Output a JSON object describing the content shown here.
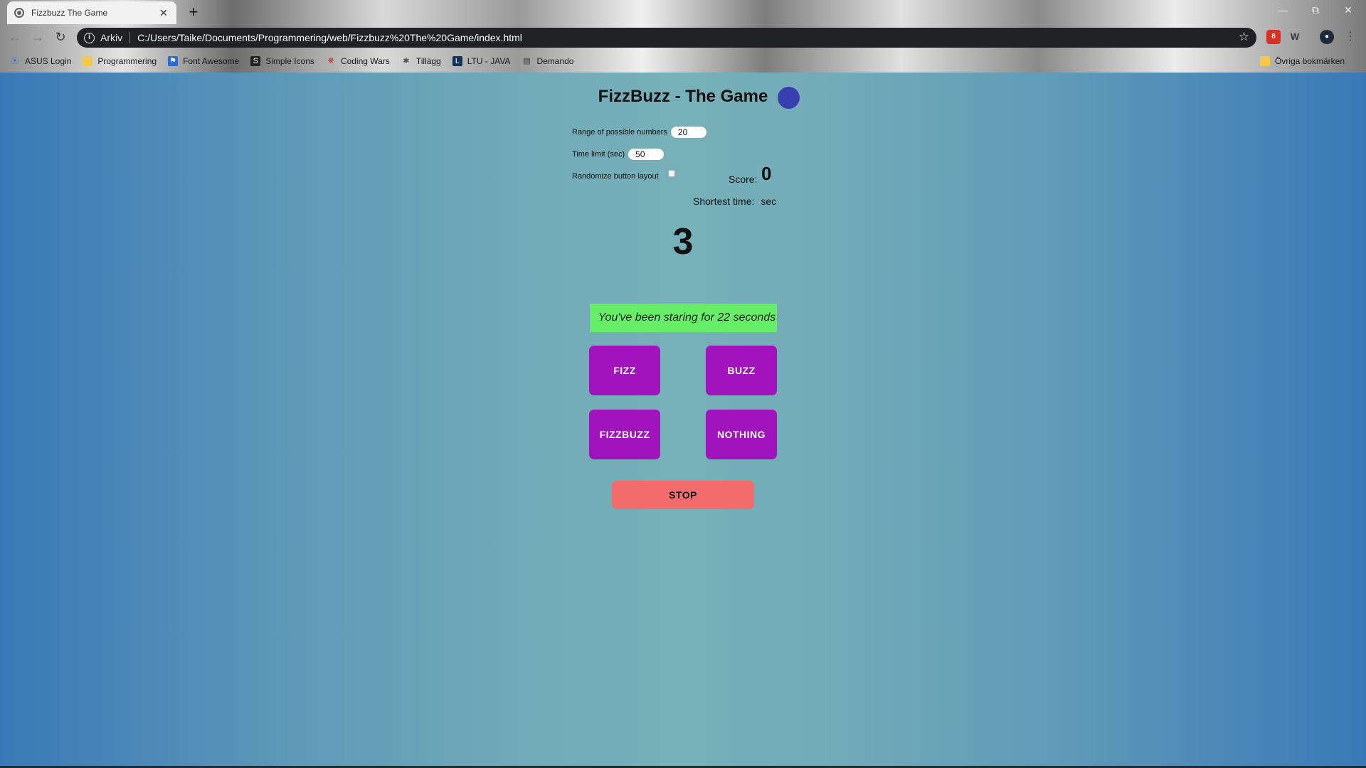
{
  "browser": {
    "tab_title": "Fizzbuzz The Game",
    "tab_close": "✕",
    "new_tab": "+",
    "address_scheme": "Arkiv",
    "address_url": "C:/Users/Taike/Documents/Programmering/web/Fizzbuzz%20The%20Game/index.html",
    "bookmarks": [
      {
        "label": "ASUS Login",
        "icon": "wifi-icon"
      },
      {
        "label": "Programmering",
        "icon": "folder-icon"
      },
      {
        "label": "Font Awesome",
        "icon": "flag-icon"
      },
      {
        "label": "Simple Icons",
        "icon": "simple-icons-icon"
      },
      {
        "label": "Coding Wars",
        "icon": "codewars-icon"
      },
      {
        "label": "Tillägg",
        "icon": "puzzle-icon"
      },
      {
        "label": "LTU - JAVA",
        "icon": "ltu-icon"
      },
      {
        "label": "Demando",
        "icon": "demando-icon"
      }
    ],
    "other_bookmarks": "Övriga bokmärken",
    "extension_badge": "8"
  },
  "game": {
    "title": "FizzBuzz - The Game",
    "range_label": "Range of possible numbers",
    "range_value": "20",
    "time_label": "Time limit (sec)",
    "time_value": "50",
    "randomize_label": "Randomize button layout",
    "randomize_checked": false,
    "score_label": "Score:",
    "score_value": "0",
    "shortest_label": "Shortest time:",
    "shortest_unit": "sec",
    "current_number": "3",
    "message": "You've been staring for 22 seconds",
    "buttons": {
      "fizz": "FIZZ",
      "buzz": "BUZZ",
      "fizzbuzz": "FIZZBUZZ",
      "nothing": "NOTHING",
      "stop": "STOP"
    }
  },
  "colors": {
    "game_button": "#a114bd",
    "stop_button": "#f26c6c",
    "message_bg": "#66ef66",
    "orb": "#3a3fb0"
  }
}
